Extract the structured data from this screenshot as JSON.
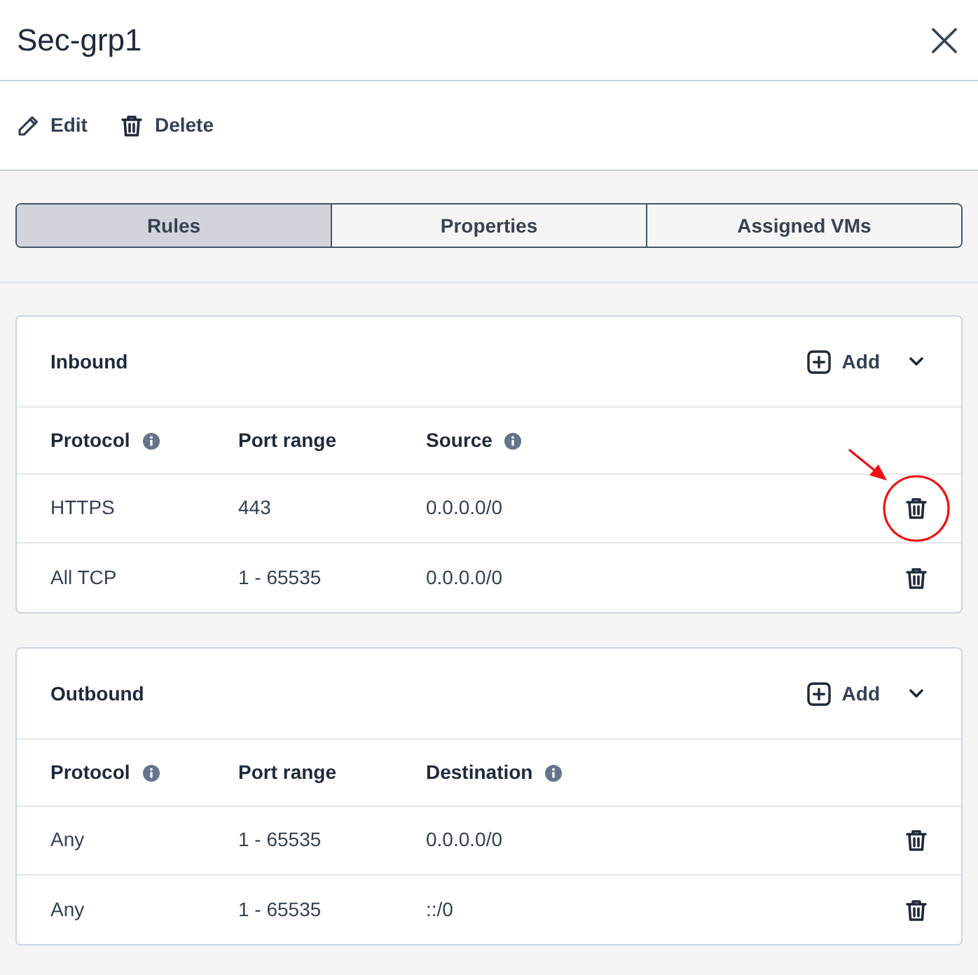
{
  "window": {
    "title": "Sec-grp1"
  },
  "toolbar": [
    {
      "kind": "edit",
      "label": "Edit"
    },
    {
      "kind": "delete",
      "label": "Delete"
    }
  ],
  "tabs": [
    {
      "label": "Rules",
      "selected": true
    },
    {
      "label": "Properties",
      "selected": false
    },
    {
      "label": "Assigned VMs",
      "selected": false
    }
  ],
  "sections": [
    {
      "title": "Inbound",
      "add_label": "Add",
      "columns": [
        {
          "label": "Protocol",
          "info": true
        },
        {
          "label": "Port range",
          "info": false
        },
        {
          "label": "Source",
          "info": true
        }
      ],
      "rows": [
        {
          "cells": [
            "HTTPS",
            "443",
            "0.0.0.0/0"
          ],
          "callout": true
        },
        {
          "cells": [
            "All TCP",
            "1 - 65535",
            "0.0.0.0/0"
          ],
          "callout": false
        }
      ]
    },
    {
      "title": "Outbound",
      "add_label": "Add",
      "columns": [
        {
          "label": "Protocol",
          "info": true
        },
        {
          "label": "Port range",
          "info": false
        },
        {
          "label": "Destination",
          "info": true
        }
      ],
      "rows": [
        {
          "cells": [
            "Any",
            "1 - 65535",
            "0.0.0.0/0"
          ],
          "callout": false
        },
        {
          "cells": [
            "Any",
            "1 - 65535",
            "::/0"
          ],
          "callout": false
        }
      ]
    }
  ]
}
